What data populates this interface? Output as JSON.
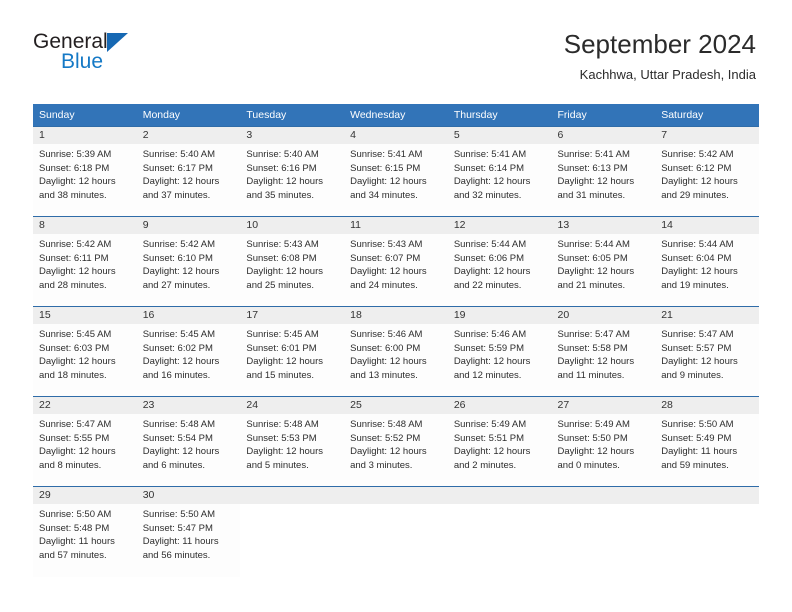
{
  "brand": {
    "name_top": "General",
    "name_bottom": "Blue",
    "triangle_color": "#1668b3",
    "blue_text_color": "#1579c6"
  },
  "header": {
    "title": "September 2024",
    "subtitle": "Kachhwa, Uttar Pradesh, India"
  },
  "theme": {
    "header_bg": "#3274b8",
    "row_border": "#2f6ca8",
    "daynum_bg": "#eeeeee"
  },
  "weekday_headers": [
    "Sunday",
    "Monday",
    "Tuesday",
    "Wednesday",
    "Thursday",
    "Friday",
    "Saturday"
  ],
  "labels": {
    "sunrise_prefix": "Sunrise:",
    "sunset_prefix": "Sunset:",
    "daylight_prefix": "Daylight:"
  },
  "days": [
    {
      "n": "1",
      "sunrise": "Sunrise: 5:39 AM",
      "sunset": "Sunset: 6:18 PM",
      "daylight_l1": "Daylight: 12 hours",
      "daylight_l2": "and 38 minutes."
    },
    {
      "n": "2",
      "sunrise": "Sunrise: 5:40 AM",
      "sunset": "Sunset: 6:17 PM",
      "daylight_l1": "Daylight: 12 hours",
      "daylight_l2": "and 37 minutes."
    },
    {
      "n": "3",
      "sunrise": "Sunrise: 5:40 AM",
      "sunset": "Sunset: 6:16 PM",
      "daylight_l1": "Daylight: 12 hours",
      "daylight_l2": "and 35 minutes."
    },
    {
      "n": "4",
      "sunrise": "Sunrise: 5:41 AM",
      "sunset": "Sunset: 6:15 PM",
      "daylight_l1": "Daylight: 12 hours",
      "daylight_l2": "and 34 minutes."
    },
    {
      "n": "5",
      "sunrise": "Sunrise: 5:41 AM",
      "sunset": "Sunset: 6:14 PM",
      "daylight_l1": "Daylight: 12 hours",
      "daylight_l2": "and 32 minutes."
    },
    {
      "n": "6",
      "sunrise": "Sunrise: 5:41 AM",
      "sunset": "Sunset: 6:13 PM",
      "daylight_l1": "Daylight: 12 hours",
      "daylight_l2": "and 31 minutes."
    },
    {
      "n": "7",
      "sunrise": "Sunrise: 5:42 AM",
      "sunset": "Sunset: 6:12 PM",
      "daylight_l1": "Daylight: 12 hours",
      "daylight_l2": "and 29 minutes."
    },
    {
      "n": "8",
      "sunrise": "Sunrise: 5:42 AM",
      "sunset": "Sunset: 6:11 PM",
      "daylight_l1": "Daylight: 12 hours",
      "daylight_l2": "and 28 minutes."
    },
    {
      "n": "9",
      "sunrise": "Sunrise: 5:42 AM",
      "sunset": "Sunset: 6:10 PM",
      "daylight_l1": "Daylight: 12 hours",
      "daylight_l2": "and 27 minutes."
    },
    {
      "n": "10",
      "sunrise": "Sunrise: 5:43 AM",
      "sunset": "Sunset: 6:08 PM",
      "daylight_l1": "Daylight: 12 hours",
      "daylight_l2": "and 25 minutes."
    },
    {
      "n": "11",
      "sunrise": "Sunrise: 5:43 AM",
      "sunset": "Sunset: 6:07 PM",
      "daylight_l1": "Daylight: 12 hours",
      "daylight_l2": "and 24 minutes."
    },
    {
      "n": "12",
      "sunrise": "Sunrise: 5:44 AM",
      "sunset": "Sunset: 6:06 PM",
      "daylight_l1": "Daylight: 12 hours",
      "daylight_l2": "and 22 minutes."
    },
    {
      "n": "13",
      "sunrise": "Sunrise: 5:44 AM",
      "sunset": "Sunset: 6:05 PM",
      "daylight_l1": "Daylight: 12 hours",
      "daylight_l2": "and 21 minutes."
    },
    {
      "n": "14",
      "sunrise": "Sunrise: 5:44 AM",
      "sunset": "Sunset: 6:04 PM",
      "daylight_l1": "Daylight: 12 hours",
      "daylight_l2": "and 19 minutes."
    },
    {
      "n": "15",
      "sunrise": "Sunrise: 5:45 AM",
      "sunset": "Sunset: 6:03 PM",
      "daylight_l1": "Daylight: 12 hours",
      "daylight_l2": "and 18 minutes."
    },
    {
      "n": "16",
      "sunrise": "Sunrise: 5:45 AM",
      "sunset": "Sunset: 6:02 PM",
      "daylight_l1": "Daylight: 12 hours",
      "daylight_l2": "and 16 minutes."
    },
    {
      "n": "17",
      "sunrise": "Sunrise: 5:45 AM",
      "sunset": "Sunset: 6:01 PM",
      "daylight_l1": "Daylight: 12 hours",
      "daylight_l2": "and 15 minutes."
    },
    {
      "n": "18",
      "sunrise": "Sunrise: 5:46 AM",
      "sunset": "Sunset: 6:00 PM",
      "daylight_l1": "Daylight: 12 hours",
      "daylight_l2": "and 13 minutes."
    },
    {
      "n": "19",
      "sunrise": "Sunrise: 5:46 AM",
      "sunset": "Sunset: 5:59 PM",
      "daylight_l1": "Daylight: 12 hours",
      "daylight_l2": "and 12 minutes."
    },
    {
      "n": "20",
      "sunrise": "Sunrise: 5:47 AM",
      "sunset": "Sunset: 5:58 PM",
      "daylight_l1": "Daylight: 12 hours",
      "daylight_l2": "and 11 minutes."
    },
    {
      "n": "21",
      "sunrise": "Sunrise: 5:47 AM",
      "sunset": "Sunset: 5:57 PM",
      "daylight_l1": "Daylight: 12 hours",
      "daylight_l2": "and 9 minutes."
    },
    {
      "n": "22",
      "sunrise": "Sunrise: 5:47 AM",
      "sunset": "Sunset: 5:55 PM",
      "daylight_l1": "Daylight: 12 hours",
      "daylight_l2": "and 8 minutes."
    },
    {
      "n": "23",
      "sunrise": "Sunrise: 5:48 AM",
      "sunset": "Sunset: 5:54 PM",
      "daylight_l1": "Daylight: 12 hours",
      "daylight_l2": "and 6 minutes."
    },
    {
      "n": "24",
      "sunrise": "Sunrise: 5:48 AM",
      "sunset": "Sunset: 5:53 PM",
      "daylight_l1": "Daylight: 12 hours",
      "daylight_l2": "and 5 minutes."
    },
    {
      "n": "25",
      "sunrise": "Sunrise: 5:48 AM",
      "sunset": "Sunset: 5:52 PM",
      "daylight_l1": "Daylight: 12 hours",
      "daylight_l2": "and 3 minutes."
    },
    {
      "n": "26",
      "sunrise": "Sunrise: 5:49 AM",
      "sunset": "Sunset: 5:51 PM",
      "daylight_l1": "Daylight: 12 hours",
      "daylight_l2": "and 2 minutes."
    },
    {
      "n": "27",
      "sunrise": "Sunrise: 5:49 AM",
      "sunset": "Sunset: 5:50 PM",
      "daylight_l1": "Daylight: 12 hours",
      "daylight_l2": "and 0 minutes."
    },
    {
      "n": "28",
      "sunrise": "Sunrise: 5:50 AM",
      "sunset": "Sunset: 5:49 PM",
      "daylight_l1": "Daylight: 11 hours",
      "daylight_l2": "and 59 minutes."
    },
    {
      "n": "29",
      "sunrise": "Sunrise: 5:50 AM",
      "sunset": "Sunset: 5:48 PM",
      "daylight_l1": "Daylight: 11 hours",
      "daylight_l2": "and 57 minutes."
    },
    {
      "n": "30",
      "sunrise": "Sunrise: 5:50 AM",
      "sunset": "Sunset: 5:47 PM",
      "daylight_l1": "Daylight: 11 hours",
      "daylight_l2": "and 56 minutes."
    }
  ],
  "grid": {
    "first_day_column_index": 0,
    "weeks": 5,
    "trailing_empty_cells": 5
  }
}
